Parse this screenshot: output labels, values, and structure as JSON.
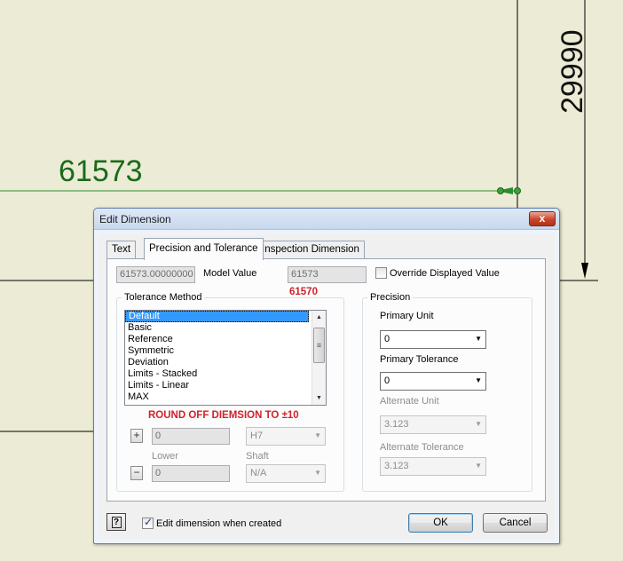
{
  "drawing": {
    "horizontal_dimension": "61573",
    "vertical_dimension": "29990",
    "colors": {
      "background": "#ecebd6",
      "dimension_green": "#1a6b1a",
      "line_black": "#000000"
    }
  },
  "dialog": {
    "title": "Edit Dimension",
    "close_glyph": "x",
    "tabs": [
      {
        "label": "Text"
      },
      {
        "label": "Precision and Tolerance"
      },
      {
        "label": "Inspection Dimension"
      }
    ],
    "active_tab": "Precision and Tolerance",
    "model_value": {
      "value": "61573.00000000",
      "label": "Model Value"
    },
    "displayed_value": "61573",
    "override_displayed_value": {
      "label": "Override Displayed Value",
      "checked": false
    },
    "red_value_note": "61570",
    "tolerance_method": {
      "title": "Tolerance Method",
      "items": [
        "Default",
        "Basic",
        "Reference",
        "Symmetric",
        "Deviation",
        "Limits - Stacked",
        "Limits - Linear",
        "MAX"
      ],
      "selected": "Default",
      "round_off_note": "ROUND OFF DIEMSION TO ±10",
      "upper_value": "0",
      "lower_label": "Lower",
      "lower_value": "0",
      "hole_value": "H7",
      "shaft_label": "Shaft",
      "shaft_value": "N/A",
      "plus_glyph": "+",
      "minus_glyph": "−"
    },
    "precision": {
      "title": "Precision",
      "primary_unit": {
        "label": "Primary Unit",
        "value": "0"
      },
      "primary_tolerance": {
        "label": "Primary Tolerance",
        "value": "0"
      },
      "alternate_unit": {
        "label": "Alternate Unit",
        "value": "3.123"
      },
      "alternate_tolerance": {
        "label": "Alternate Tolerance",
        "value": "3.123"
      }
    },
    "footer": {
      "help_glyph": "?",
      "edit_when_created": {
        "label": "Edit dimension when created",
        "checked": true
      },
      "ok_label": "OK",
      "cancel_label": "Cancel"
    }
  }
}
